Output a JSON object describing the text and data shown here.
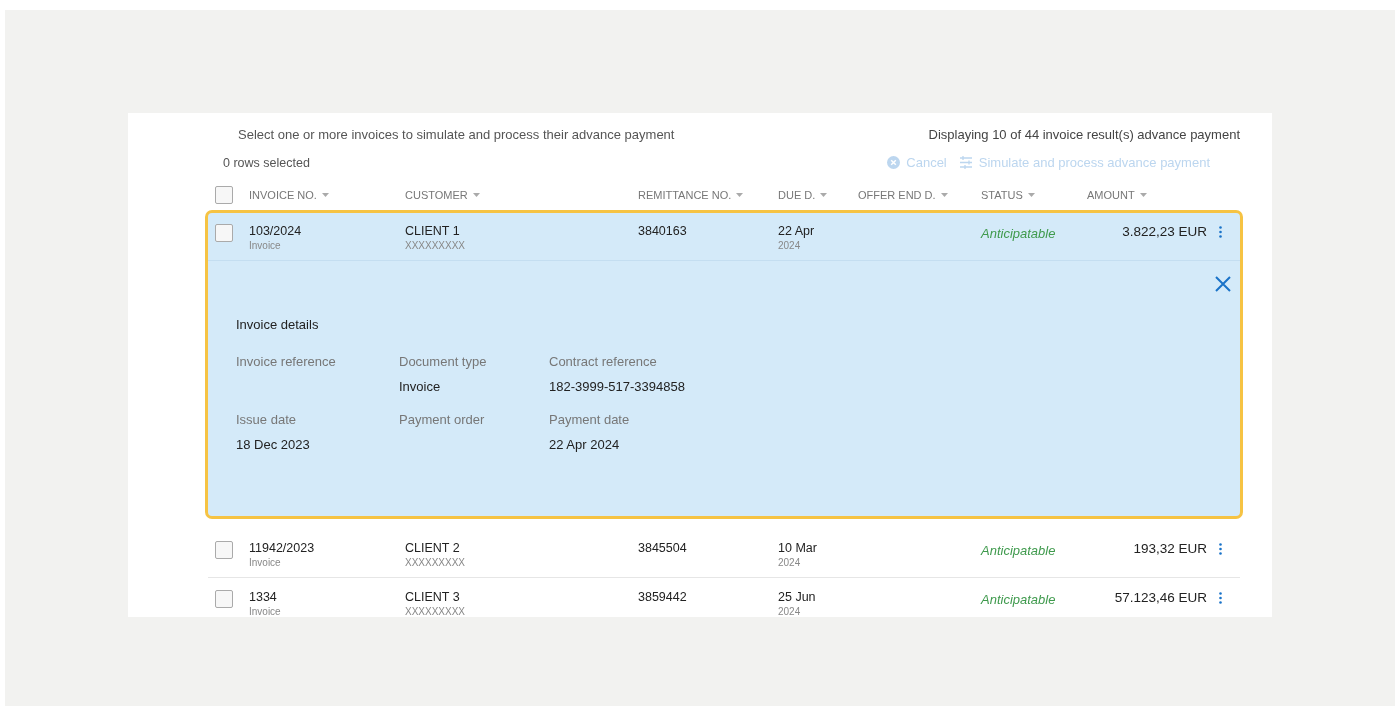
{
  "instructions": "Select one or more invoices to simulate and process their advance payment",
  "result_count": "Displaying 10 of 44 invoice result(s) advance payment",
  "selection_count": "0 rows selected",
  "actions": [
    {
      "kind": "cancel",
      "label": "Cancel",
      "disabled": true
    },
    {
      "kind": "simulate",
      "label": "Simulate and process advance payment",
      "disabled": true
    }
  ],
  "select_all": {
    "checked": false
  },
  "columns": [
    "INVOICE NO.",
    "CUSTOMER",
    "REMITTANCE NO.",
    "DUE D.",
    "OFFER END D.",
    "STATUS",
    "AMOUNT"
  ],
  "rows": [
    {
      "checked": false,
      "expanded": true,
      "invoice_no": "103/2024",
      "invoice_type": "Invoice",
      "customer": "CLIENT 1",
      "customer_id": "XXXXXXXXX",
      "remittance_no": "3840163",
      "due_day": "22 Apr",
      "due_year": "2024",
      "status": "Anticipatable",
      "amount": "3.822,23 EUR",
      "details": {
        "title": "Invoice details",
        "fields": [
          {
            "label": "Invoice reference"
          },
          {
            "label": "Document type",
            "value": "Invoice"
          },
          {
            "label": "Contract reference",
            "value": "182-3999-517-3394858"
          },
          {
            "label": "Issue date",
            "value": "18 Dec 2023"
          },
          {
            "label": "Payment order"
          },
          {
            "label": "Payment date",
            "value": "22 Apr 2024"
          }
        ]
      }
    },
    {
      "checked": false,
      "expanded": false,
      "invoice_no": "11942/2023",
      "invoice_type": "Invoice",
      "customer": "CLIENT 2",
      "customer_id": "XXXXXXXXX",
      "remittance_no": "3845504",
      "due_day": "10 Mar",
      "due_year": "2024",
      "status": "Anticipatable",
      "amount": "193,32 EUR"
    },
    {
      "checked": false,
      "expanded": false,
      "invoice_no": "1334",
      "invoice_type": "Invoice",
      "customer": "CLIENT 3",
      "customer_id": "XXXXXXXXX",
      "remittance_no": "3859442",
      "due_day": "25 Jun",
      "due_year": "2024",
      "status": "Anticipatable",
      "amount": "57.123,46 EUR"
    }
  ]
}
